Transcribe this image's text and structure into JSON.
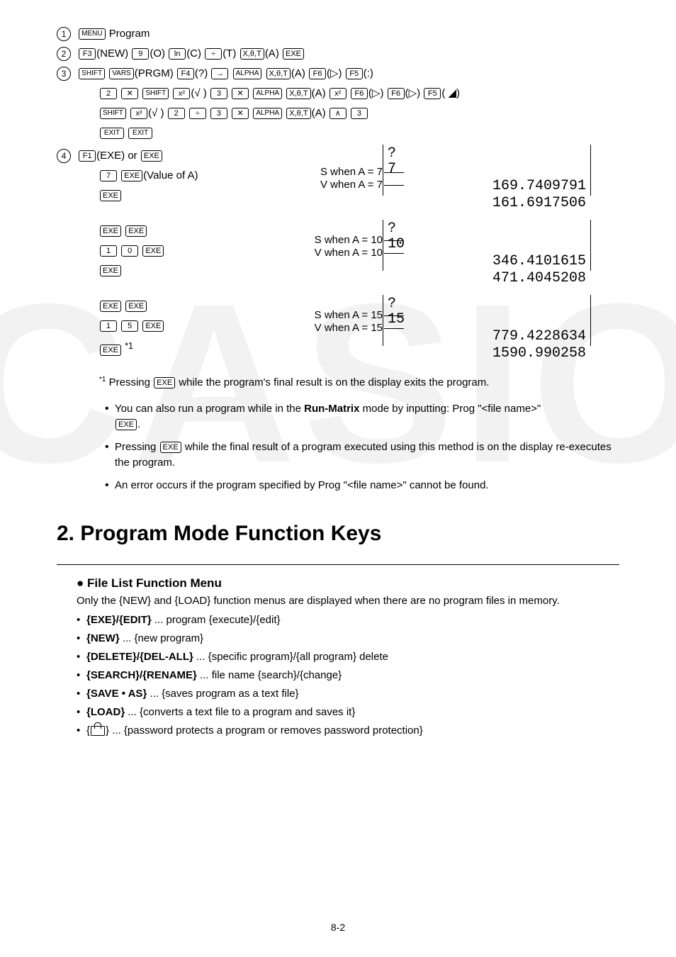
{
  "steps": {
    "s1": {
      "label": "Program"
    },
    "s2": {
      "parts": [
        "(NEW)",
        "(O)",
        "(C)",
        "(T)",
        "(A)"
      ]
    },
    "s3": {
      "line1": [
        "(PRGM)",
        "(?)",
        "(A)",
        "(▷)",
        "(:)"
      ],
      "line2": [
        "(√  )",
        "(A)",
        "(▷)",
        "(▷)",
        "( ◢)"
      ],
      "line3": [
        "(√  )",
        "(A)"
      ]
    },
    "s4": {
      "label_exe": "(EXE) or",
      "value_of_a": "(Value of A)"
    }
  },
  "calc": [
    {
      "s_label": "S when A = 7",
      "v_label": "V when A = 7",
      "top1": "?",
      "top2": "7",
      "bot1": "169.7409791",
      "bot2": "161.6917506"
    },
    {
      "s_label": "S when A = 10",
      "v_label": "V when A = 10",
      "top1": "?",
      "top2": "10",
      "bot1": "346.4101615",
      "bot2": "471.4045208"
    },
    {
      "s_label": "S when A = 15",
      "v_label": "V when A = 15",
      "top1": "?",
      "top2": "15",
      "bot1": "779.4228634",
      "bot2": "1590.990258"
    }
  ],
  "footnote": "Pressing",
  "footnote_tail": "while the program's final result is on the display exits the program.",
  "bullets": {
    "b1a": "You can also run a program while in the ",
    "b1b": "Run-Matrix",
    "b1c": " mode by inputting: Prog \"<file name>\"",
    "b1d": ".",
    "b2a": "Pressing ",
    "b2b": " while the final result of a program executed using this method is on the display re-executes the program.",
    "b3": "An error occurs if the program specified by Prog \"<file name>\" cannot be found."
  },
  "section_title": "2. Program Mode Function Keys",
  "file_menu": {
    "heading": "File List Function Menu",
    "intro": "Only the {NEW} and {LOAD} function menus are displayed when there are no program files in memory.",
    "items": [
      {
        "k": "{EXE}/{EDIT}",
        "d": " ... program {execute}/{edit}"
      },
      {
        "k": "{NEW}",
        "d": " ... {new program}"
      },
      {
        "k": "{DELETE}/{DEL-ALL}",
        "d": " ... {specific program}/{all program} delete"
      },
      {
        "k": "{SEARCH}/{RENAME}",
        "d": " ... file name {search}/{change}"
      },
      {
        "k": "{SAVE • AS}",
        "d": " ... {saves program as a text file}"
      },
      {
        "k": "{LOAD}",
        "d": " ... {converts a text file to a program and saves it}"
      }
    ],
    "lock_desc": " ... {password protects a program or removes password protection}"
  },
  "keys": {
    "menu": "MENU",
    "f1": "F1",
    "f3": "F3",
    "f4": "F4",
    "f5": "F5",
    "f6": "F6",
    "nine": "9",
    "ln": "ln",
    "div": "÷",
    "xot": "X,θ,T",
    "exe": "EXE",
    "shift": "SHIFT",
    "vars": "VARS",
    "arrow": "→",
    "alpha": "ALPHA",
    "two": "2",
    "mult": "✕",
    "x2": "x²",
    "three": "3",
    "exit": "EXIT",
    "seven": "7",
    "one": "1",
    "zero": "0",
    "five": "5",
    "pow": "∧"
  },
  "pagenum": "8-2"
}
